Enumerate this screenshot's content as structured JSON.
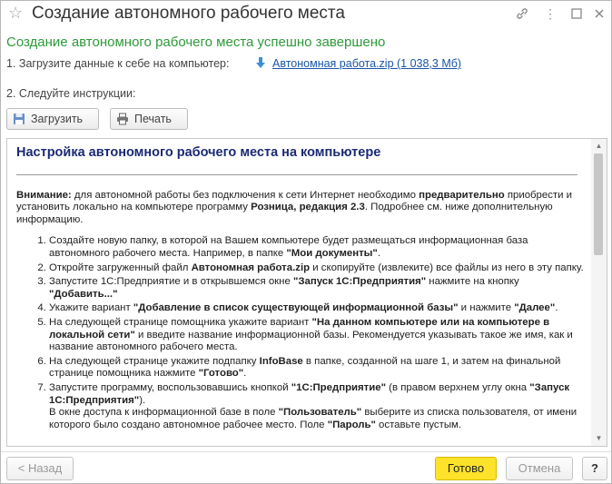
{
  "window": {
    "title": "Создание автономного рабочего места",
    "icons": [
      "star-icon",
      "link-icon",
      "more-icon",
      "maximize-icon",
      "close-icon"
    ]
  },
  "header": {
    "success_text": "Создание автономного рабочего места успешно завершено",
    "step1_label": "1. Загрузите данные к себе на компьютер:",
    "download_link": "Автономная работа.zip (1 038,3 Мб)",
    "step2_label": "2. Следуйте инструкции:"
  },
  "toolbar": {
    "download_label": "Загрузить",
    "print_label": "Печать"
  },
  "instructions": {
    "heading": "Настройка автономного рабочего места на компьютере",
    "note_bold": "Внимание:",
    "note_1": " для автономной работы без подключения к сети Интернет необходимо ",
    "note_bold2": "предварительно",
    "note_2": " приобрести и установить локально на компьютере программу ",
    "note_bold3": "Розница, редакция 2.3",
    "note_3": ". Подробнее см. ниже дополнительную информацию.",
    "steps": [
      {
        "a": "Создайте новую папку, в которой на Вашем компьютере будет размещаться информационная база автономного рабочего места. Например, в папке ",
        "b": "\"Мои документы\"",
        "c": "."
      },
      {
        "a": "Откройте загруженный файл ",
        "b": "Автономная работа.zip",
        "c": " и скопируйте (извлеките) все файлы из него в эту папку."
      },
      {
        "a": "Запустите 1С:Предприятие и в открывшемся окне ",
        "b": "\"Запуск 1С:Предприятия\"",
        "c": " нажмите на кнопку ",
        "d": "\"Добавить...\""
      },
      {
        "a": "Укажите вариант ",
        "b": "\"Добавление в список существующей информационной базы\"",
        "c": " и нажмите ",
        "d": "\"Далее\"",
        "e": "."
      },
      {
        "a": "На следующей странице помощника укажите вариант ",
        "b": "\"На данном компьютере или на компьютере в локальной сети\"",
        "c": " и введите название информационной базы. Рекомендуется указывать такое же имя, как и название автономного рабочего места."
      },
      {
        "a": "На следующей странице укажите подпапку ",
        "b": "InfoBase",
        "c": " в папке, созданной на шаге 1, и затем на финальной странице помощника нажмите ",
        "d": "\"Готово\"",
        "e": "."
      },
      {
        "a": "Запустите программу, воспользовавшись кнопкой ",
        "b": "\"1С:Предприятие\"",
        "c": " (в правом верхнем углу окна ",
        "d": "\"Запуск 1С:Предприятия\"",
        "e": ").",
        "f": "В окне доступа к информационной базе в поле ",
        "g": "\"Пользователь\"",
        "h": " выберите из списка пользователя, от имени которого было создано автономное рабочее место. Поле ",
        "i": "\"Пароль\"",
        "j": " оставьте пустым."
      }
    ]
  },
  "footer": {
    "back_label": "< Назад",
    "done_label": "Готово",
    "cancel_label": "Отмена",
    "help_label": "?"
  },
  "colors": {
    "success_green": "#2e9a3a",
    "link_blue": "#1a55a8",
    "heading_navy": "#1b2a74",
    "primary_yellow": "#ffe22a"
  }
}
